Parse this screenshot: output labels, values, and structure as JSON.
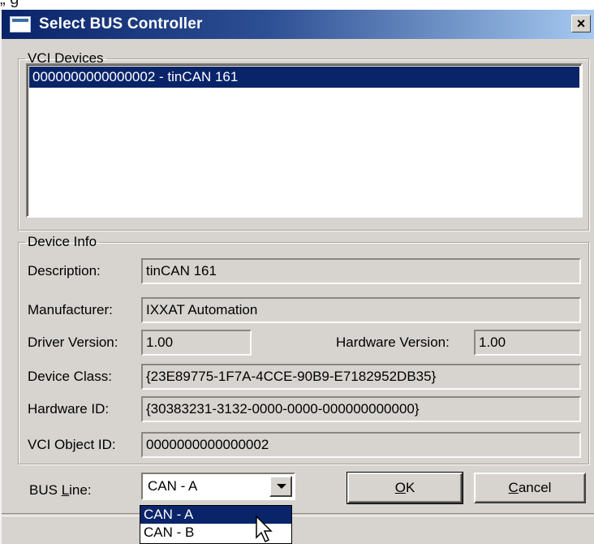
{
  "clipped_text": "„                                                    g",
  "window": {
    "title": "Select BUS Controller",
    "close_glyph": "×"
  },
  "vci_devices": {
    "legend_pre": "VCI ",
    "legend_key": "D",
    "legend_post": "evices",
    "items": [
      "0000000000000002 - tinCAN 161"
    ]
  },
  "device_info": {
    "legend": "Device Info",
    "description_label": "Description:",
    "description_value": "tinCAN 161",
    "manufacturer_label": "Manufacturer:",
    "manufacturer_value": "IXXAT Automation",
    "driver_version_label": "Driver Version:",
    "driver_version_value": "1.00",
    "hardware_version_label": "Hardware Version:",
    "hardware_version_value": "1.00",
    "device_class_label": "Device Class:",
    "device_class_value": "{23E89775-1F7A-4CCE-90B9-E7182952DB35}",
    "hardware_id_label": "Hardware ID:",
    "hardware_id_value": "{30383231-3132-0000-0000-000000000000}",
    "vci_object_id_label": "VCI Object ID:",
    "vci_object_id_value": "0000000000000002"
  },
  "bus_line": {
    "label_pre": "BUS ",
    "label_key": "L",
    "label_post": "ine:",
    "selected": "CAN - A",
    "options": [
      "CAN - A",
      "CAN - B"
    ]
  },
  "buttons": {
    "ok_key": "O",
    "ok_rest": "K",
    "cancel_key": "C",
    "cancel_rest": "ancel"
  }
}
